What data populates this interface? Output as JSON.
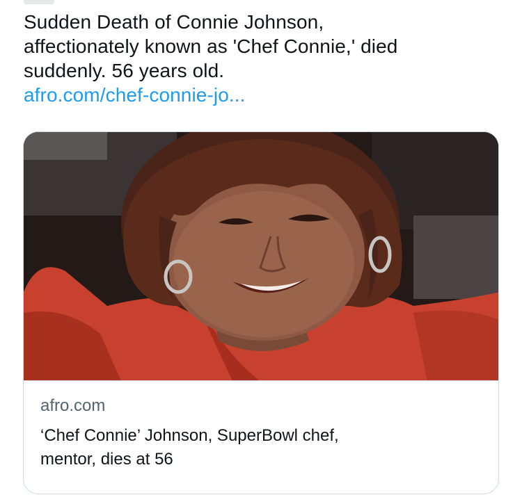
{
  "tweet": {
    "text_lines": [
      "Sudden Death of Connie Johnson,",
      "affectionately known as 'Chef Connie,' died",
      "suddenly. 56 years old."
    ],
    "link_text": "afro.com/chef-connie-jo..."
  },
  "card": {
    "image_description_icon": "woman-portrait-image",
    "domain": "afro.com",
    "title_lines": [
      "‘Chef Connie’ Johnson, SuperBowl chef,",
      "mentor, dies at 56"
    ]
  },
  "colors": {
    "text": "#0f1419",
    "link": "#1d9bf0",
    "secondary": "#536471",
    "border": "#cfd9de",
    "jacket_red": "#c8402e"
  }
}
